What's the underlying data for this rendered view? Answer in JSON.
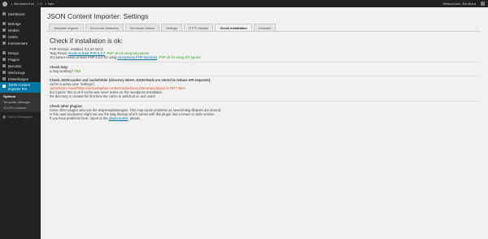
{
  "adminbar": {
    "site_name": "Bernhard Kux",
    "comments_count": "0",
    "new_label": "+ Neu",
    "greeting": "Willkommen, Bernhard"
  },
  "sidebar": {
    "items": [
      {
        "label": "Dashboard",
        "icon": "dashboard-icon"
      },
      {
        "label": "Beiträge",
        "icon": "pin-icon"
      },
      {
        "label": "Medien",
        "icon": "media-icon"
      },
      {
        "label": "Seiten",
        "icon": "page-icon"
      },
      {
        "label": "Kommentare",
        "icon": "comment-icon"
      },
      {
        "label": "Design",
        "icon": "brush-icon"
      },
      {
        "label": "Plugins",
        "icon": "plugin-icon"
      },
      {
        "label": "Benutzer",
        "icon": "user-icon"
      },
      {
        "label": "Werkzeuge",
        "icon": "wrench-icon"
      },
      {
        "label": "Einstellungen",
        "icon": "settings-icon"
      }
    ],
    "current": {
      "label": "JSON Content Importer Pro",
      "icon": "json-icon"
    },
    "submenu": [
      "Options",
      "Template-Manager",
      "JCI-Pro License"
    ],
    "collapse_label": "Menü einklappen"
  },
  "page": {
    "title": "JSON Content Importer: Settings",
    "tabs": [
      "Template engines",
      "Shortcode Attributes",
      "Shortcode-Values",
      "Settings",
      "HTTP-Header",
      "Check installation",
      "Uninstall"
    ],
    "active_tab": "Check installation",
    "heading": "Check if installation is ok:",
    "php": {
      "line1": "PHP-Version: installed: 5.5.31-nmn1",
      "twig_prefix": "Twig-Parser ",
      "twig_link": "needs at least PHP 5.2.7",
      "twig_ok": ": PHP ok for using twig-parser",
      "jci_prefix": "JCI-parser needs at least PHP 5.3.0 for using ",
      "jci_link": "Anonymous PHP-functions",
      "jci_ok": ": PHP ok for using JCI-parser"
    },
    "twig": {
      "title": "Check twig:",
      "text": "is twig working? ",
      "status": "YES"
    },
    "cache": {
      "title": "Check JSON-cacher and cachefolder (directory where JSON-feeds are stored to reduce API-requests):",
      "line1": "cache is active (see 'Settings')",
      "line2": "cachefolder /www/htdocs/tuvhpa/wp/wp-content/cache/jsoncontentimporterpro/ is NOT there",
      "line3": "don't panic: this is ok if cache was never active on this wordpress installation.",
      "line4": "the directory is created the first time the cache is switched on and used!"
    },
    "plugins": {
      "title": "Check other plugins:",
      "line1": "Some other plugins also use the twig-templateengine. This may cause problems as several twig-libraries are around:",
      "line2": "in this case wordpress might not use the twig-libraray which comes with this plugin. But a newer or older version.",
      "line3_prefix": "If you have problems here, report to the ",
      "line3_link": "plugin-author",
      "line3_suffix": ", please."
    }
  },
  "colors": {
    "adminbar": "#222222",
    "sidebar": "#222222",
    "active_menu": "#0074a2",
    "ok_green": "#3a9d23",
    "error_red": "#d54e21",
    "link": "#0074a2"
  }
}
